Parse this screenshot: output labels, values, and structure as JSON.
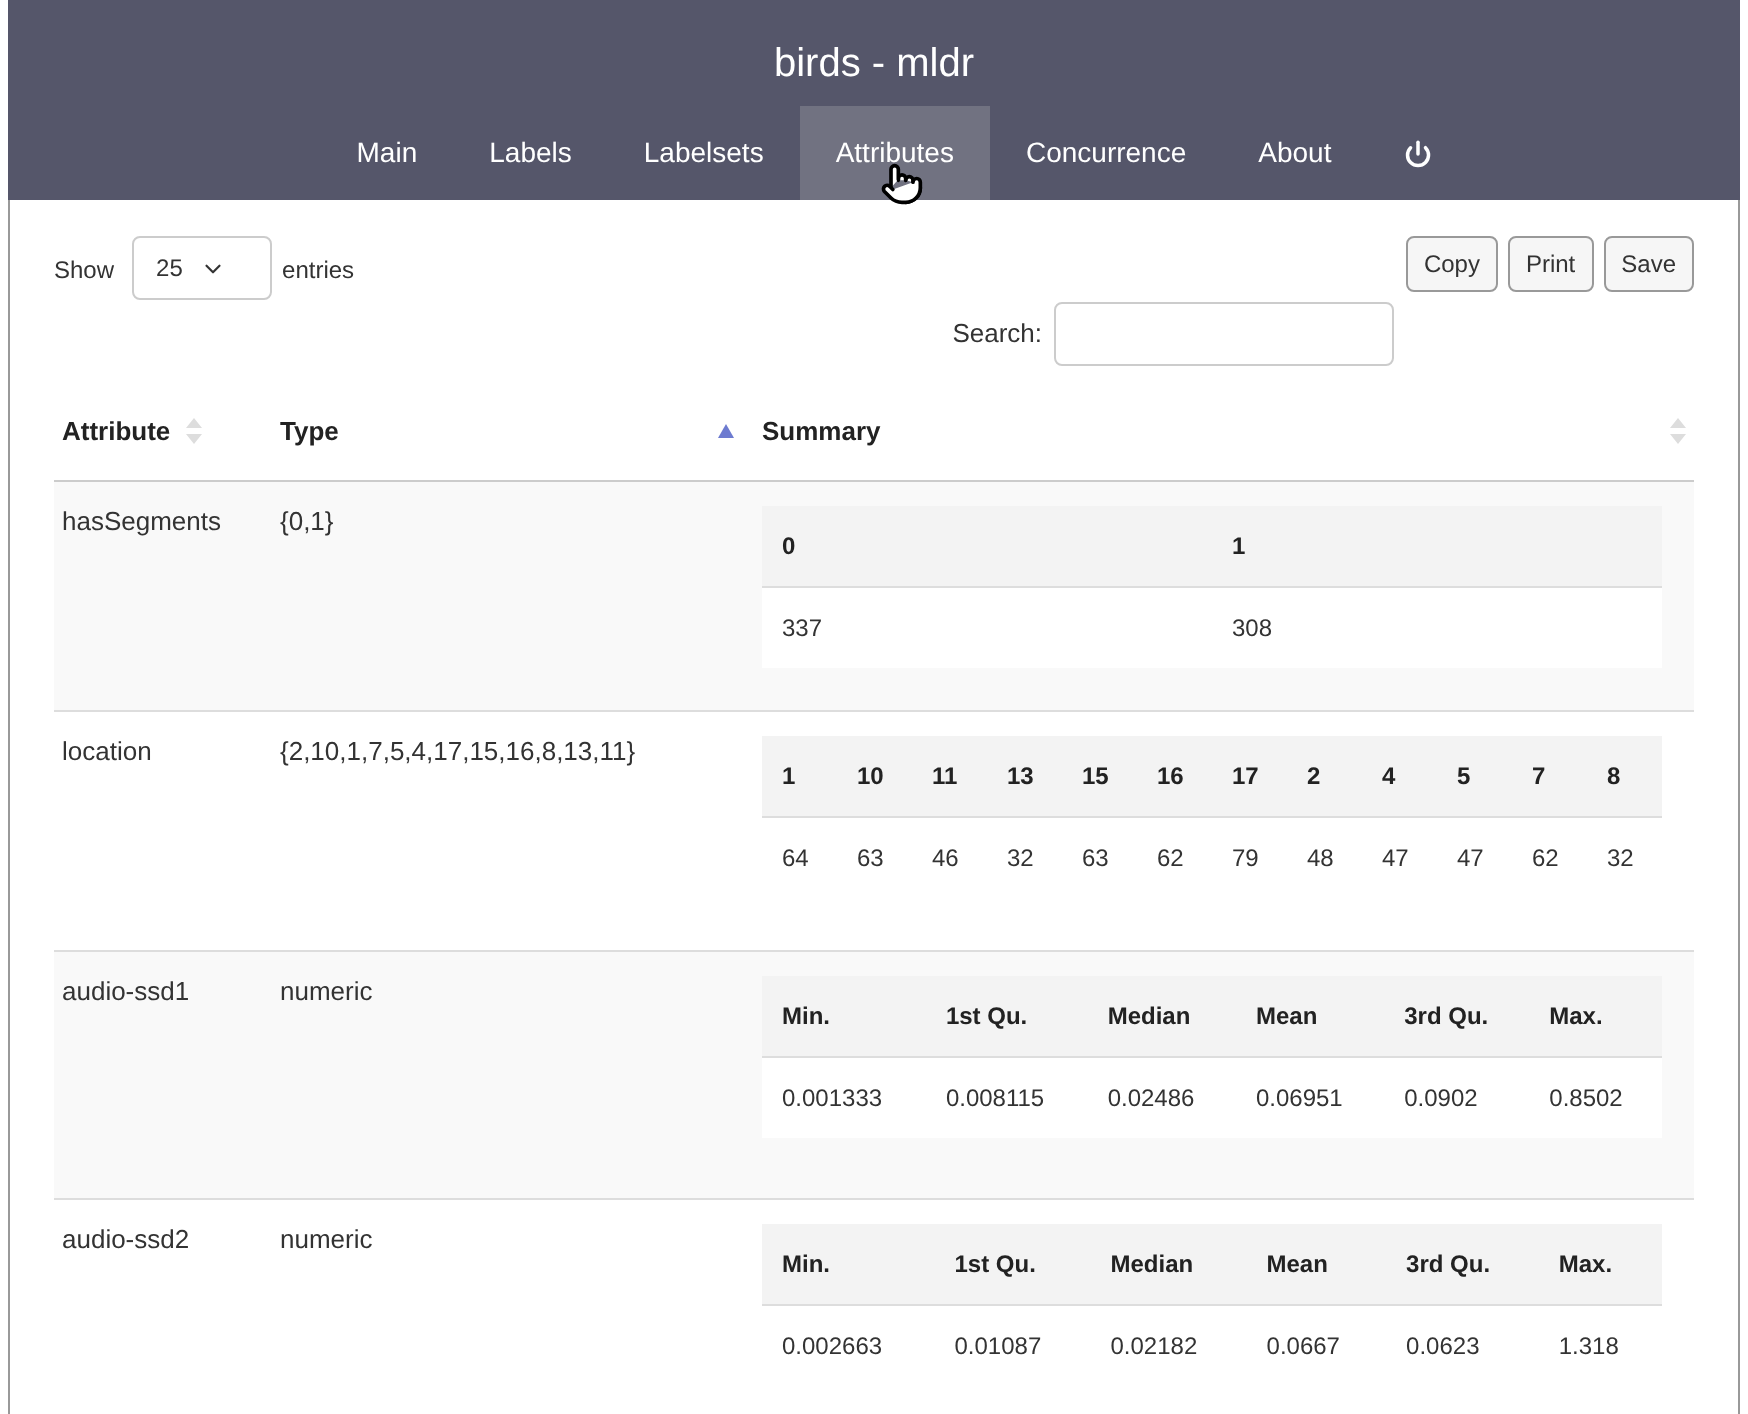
{
  "title": "birds - mldr",
  "nav": [
    {
      "label": "Main",
      "selected": false
    },
    {
      "label": "Labels",
      "selected": false
    },
    {
      "label": "Labelsets",
      "selected": false
    },
    {
      "label": "Attributes",
      "selected": true
    },
    {
      "label": "Concurrence",
      "selected": false
    },
    {
      "label": "About",
      "selected": false
    },
    {
      "kind": "power",
      "selected": false
    }
  ],
  "length_menu": {
    "before": "Show",
    "value": "25",
    "after": "entries"
  },
  "buttons": [
    "Copy",
    "Print",
    "Save"
  ],
  "search": {
    "label": "Search:"
  },
  "columns": [
    {
      "label": "Attribute",
      "sorted": false
    },
    {
      "label": "Type",
      "sorted": true
    },
    {
      "label": "Summary",
      "sorted": false
    }
  ],
  "rows": [
    {
      "attribute": "hasSegments",
      "type": "{0,1}",
      "summary": {
        "headers": [
          "0",
          "1"
        ],
        "values": [
          "337",
          "308"
        ]
      }
    },
    {
      "attribute": "location",
      "type": "{2,10,1,7,5,4,17,15,16,8,13,11}",
      "summary": {
        "headers": [
          "1",
          "10",
          "11",
          "13",
          "15",
          "16",
          "17",
          "2",
          "4",
          "5",
          "7",
          "8"
        ],
        "values": [
          "64",
          "63",
          "46",
          "32",
          "63",
          "62",
          "79",
          "48",
          "47",
          "47",
          "62",
          "32"
        ]
      }
    },
    {
      "attribute": "audio-ssd1",
      "type": "numeric",
      "summary": {
        "headers": [
          "Min.",
          "1st Qu.",
          "Median",
          "Mean",
          "3rd Qu.",
          "Max."
        ],
        "values": [
          "0.001333",
          "0.008115",
          "0.02486",
          "0.06951",
          "0.0902",
          "0.8502"
        ]
      }
    },
    {
      "attribute": "audio-ssd2",
      "type": "numeric",
      "summary": {
        "headers": [
          "Min.",
          "1st Qu.",
          "Median",
          "Mean",
          "3rd Qu.",
          "Max."
        ],
        "values": [
          "0.002663",
          "0.01087",
          "0.02182",
          "0.0667",
          "0.0623",
          "1.318"
        ]
      }
    }
  ]
}
